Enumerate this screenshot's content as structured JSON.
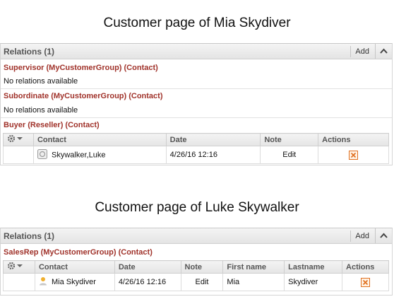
{
  "captions": {
    "first": "Customer page of Mia Skydiver",
    "second": "Customer page of Luke Skywalker"
  },
  "panel1": {
    "title": "Relations (1)",
    "add_label": "Add",
    "supervisor_heading": "Supervisor (MyCustomerGroup) (Contact)",
    "supervisor_empty": "No relations available",
    "subordinate_heading": "Subordinate (MyCustomerGroup) (Contact)",
    "subordinate_empty": "No relations available",
    "buyer_heading": "Buyer (Reseller) (Contact)",
    "table": {
      "columns": [
        "Contact",
        "Date",
        "Note",
        "Actions"
      ],
      "rows": [
        {
          "contact": "Skywalker,Luke",
          "date": "4/26/16 12:16",
          "note": "Edit"
        }
      ]
    }
  },
  "panel2": {
    "title": "Relations (1)",
    "add_label": "Add",
    "salesrep_heading": "SalesRep (MyCustomerGroup) (Contact)",
    "table": {
      "columns": [
        "Contact",
        "Date",
        "Note",
        "First name",
        "Lastname",
        "Actions"
      ],
      "rows": [
        {
          "contact": "Mia Skydiver",
          "date": "4/26/16 12:16",
          "note": "Edit",
          "first_name": "Mia",
          "last_name": "Skydiver"
        }
      ]
    }
  },
  "colors": {
    "heading_red": "#a0322a",
    "delete_orange": "#e07020"
  }
}
